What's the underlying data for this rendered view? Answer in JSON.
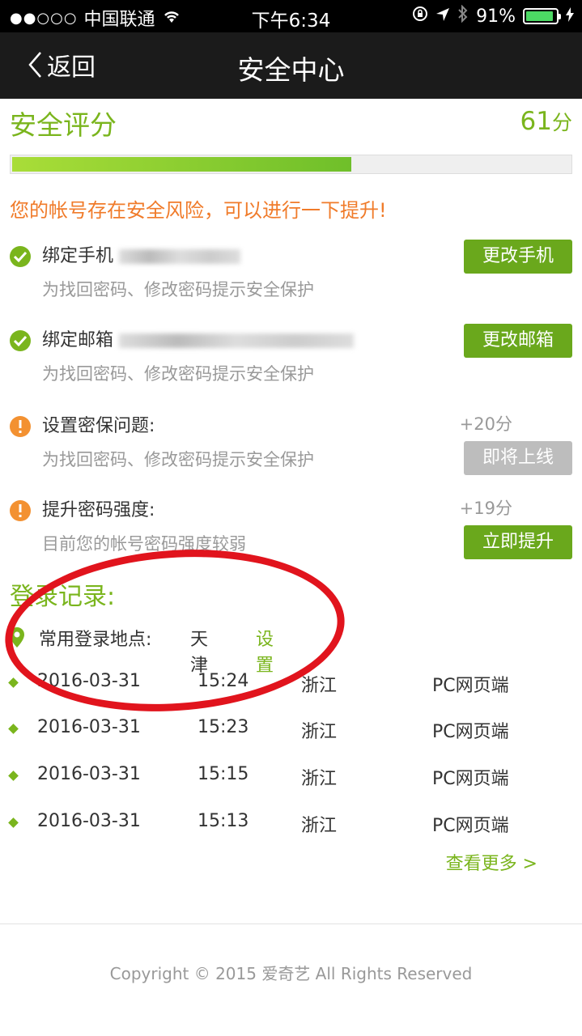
{
  "status_bar": {
    "signal_dots": "●●○○○",
    "carrier": "中国联通",
    "wifi_icon": "wifi-icon",
    "time": "下午6:34",
    "battery_percent": "91%",
    "battery_level": 0.91
  },
  "nav": {
    "back_label": "返回",
    "title": "安全中心"
  },
  "score": {
    "title": "安全评分",
    "value": "61",
    "unit": "分",
    "progress": 0.61,
    "bar_color": "#7ab51d"
  },
  "warning_text": "您的帐号存在安全风险，可以进行一下提升!",
  "items": [
    {
      "title": "绑定手机",
      "desc": "为找回密码、修改密码提示安全保护",
      "button": "更改手机",
      "status": "ok"
    },
    {
      "title": "绑定邮箱",
      "desc": "为找回密码、修改密码提示安全保护",
      "button": "更改邮箱",
      "status": "ok"
    },
    {
      "title": "设置密保问题:",
      "desc": "为找回密码、修改密码提示安全保护",
      "bonus": "+20分",
      "button": "即将上线",
      "status": "warn"
    },
    {
      "title": "提升密码强度:",
      "desc": "目前您的帐号密码强度较弱",
      "bonus": "+19分",
      "button": "立即提升",
      "status": "warn"
    }
  ],
  "login": {
    "title": "登录记录:",
    "location_label": "常用登录地点:",
    "location_value": "天津",
    "location_setting": "设置",
    "records": [
      {
        "date": "2016-03-31",
        "time": "15:24",
        "place": "浙江",
        "device": "PC网页端"
      },
      {
        "date": "2016-03-31",
        "time": "15:23",
        "place": "浙江",
        "device": "PC网页端"
      },
      {
        "date": "2016-03-31",
        "time": "15:15",
        "place": "浙江",
        "device": "PC网页端"
      },
      {
        "date": "2016-03-31",
        "time": "15:13",
        "place": "浙江",
        "device": "PC网页端"
      }
    ],
    "more": "查看更多 >"
  },
  "footer": {
    "copyright": "Copyright © 2015 爱奇艺 All Rights Reserved"
  },
  "colors": {
    "accent": "#7ab51d",
    "warning": "#f07b2a",
    "annotation": "#e1141d"
  }
}
